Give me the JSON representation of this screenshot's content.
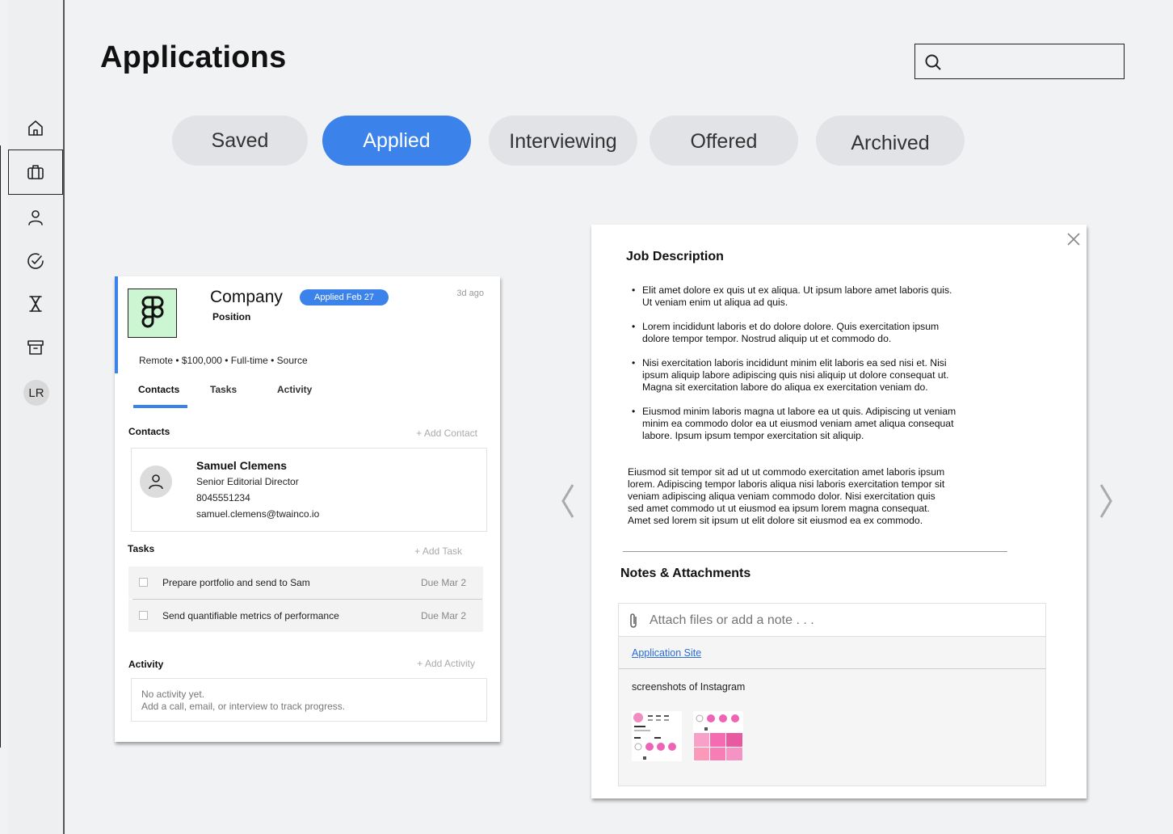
{
  "page": {
    "title": "Applications"
  },
  "search": {
    "placeholder": "",
    "value": ""
  },
  "sidebar": {
    "items": [
      {
        "name": "home",
        "icon": "home-icon"
      },
      {
        "name": "applications",
        "icon": "briefcase-icon",
        "active": true
      },
      {
        "name": "contacts",
        "icon": "user-icon"
      },
      {
        "name": "tasks",
        "icon": "check-circle-icon"
      },
      {
        "name": "pending",
        "icon": "hourglass-icon"
      },
      {
        "name": "archive",
        "icon": "archive-icon"
      }
    ],
    "avatar_initials": "LR"
  },
  "filters": [
    {
      "label": "Saved",
      "active": false
    },
    {
      "label": "Applied",
      "active": true
    },
    {
      "label": "Interviewing",
      "active": false
    },
    {
      "label": "Offered",
      "active": false
    },
    {
      "label": "Archived",
      "active": false
    }
  ],
  "card": {
    "company": "Company",
    "position": "Position",
    "badge": "Applied Feb 27",
    "ago": "3d ago",
    "meta": "Remote • $100,000 • Full-time • Source",
    "tabs": [
      "Contacts",
      "Tasks",
      "Activity"
    ],
    "contacts": {
      "title": "Contacts",
      "add_label": "+ Add Contact",
      "person": {
        "name": "Samuel Clemens",
        "role": "Senior Editorial Director",
        "phone": "8045551234",
        "email": "samuel.clemens@twainco.io"
      }
    },
    "tasks": {
      "title": "Tasks",
      "add_label": "+ Add Task",
      "items": [
        {
          "text": "Prepare portfolio and send to Sam",
          "due": "Due Mar 2"
        },
        {
          "text": "Send quantifiable metrics of performance",
          "due": "Due Mar 2"
        }
      ]
    },
    "activity": {
      "title": "Activity",
      "add_label": "+ Add Activity",
      "empty_line1": "No activity yet.",
      "empty_line2": "Add a call, email, or interview to track progress."
    }
  },
  "panel": {
    "job_description_title": "Job Description",
    "bullets": [
      "Elit amet dolore ex quis ut ex aliqua. Ut ipsum labore amet laboris quis. Ut veniam enim ut aliqua ad quis.",
      "Lorem incididunt laboris et do dolore dolore. Quis exercitation ipsum dolore tempor tempor. Nostrud aliquip ut et commodo do.",
      "Nisi exercitation laboris incididunt minim elit laboris ea sed nisi et. Nisi ipsum aliquip labore adipiscing quis nisi aliquip ut dolore consequat ut. Magna sit exercitation labore do aliqua ex exercitation veniam do.",
      "Eiusmod minim laboris magna ut labore ea ut quis. Adipiscing ut veniam minim ea commodo dolor ea ut eiusmod veniam amet aliqua consequat labore. Ipsum ipsum tempor exercitation sit aliquip."
    ],
    "paragraph": "Eiusmod sit tempor sit ad ut ut commodo exercitation amet laboris ipsum lorem. Adipiscing tempor laboris aliqua nisi laboris exercitation tempor sit veniam adipiscing aliqua veniam commodo dolor. Nisi exercitation quis sed amet commodo ut ut eiusmod ea ipsum lorem magna consequat. Amet sed lorem sit ipsum ut elit dolore sit eiusmod ea ex commodo.",
    "notes_title": "Notes & Attachments",
    "attach_placeholder": "Attach files or add a note . . .",
    "link_label": "Application Site",
    "screenshots_label": "screenshots of Instagram"
  },
  "colors": {
    "accent": "#3b82ea",
    "logo_bg": "#ccf5d2",
    "link": "#2a6bd6"
  }
}
